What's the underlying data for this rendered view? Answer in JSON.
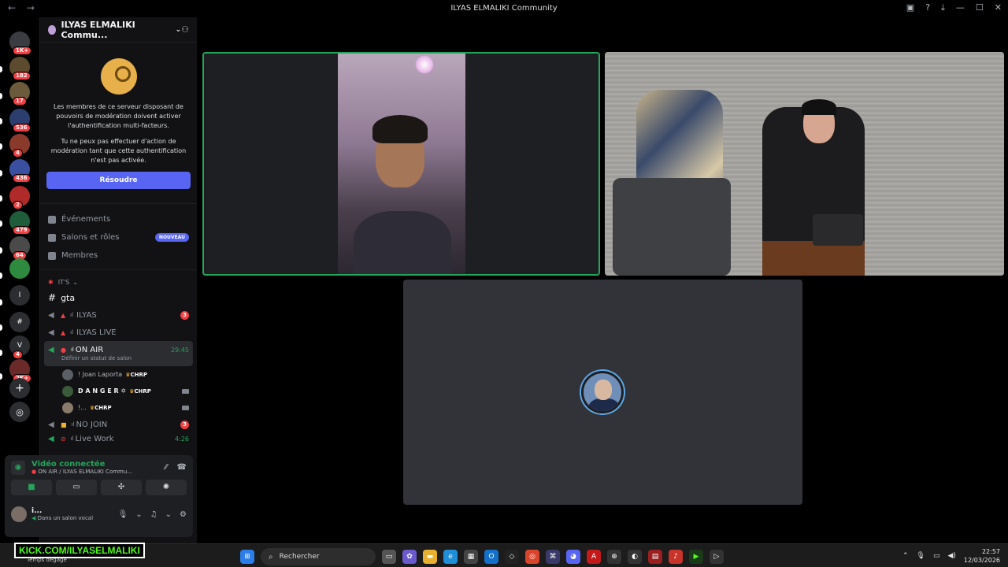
{
  "window": {
    "title": "ILYAS ELMALIKI Community",
    "nav_back": "←",
    "nav_forward": "→"
  },
  "guilds": [
    {
      "label": "1K+",
      "color": "#3a3c42"
    },
    {
      "label": "182",
      "color": "#5c4b2e"
    },
    {
      "label": "17",
      "color": "#6b5a3c"
    },
    {
      "label": "536",
      "color": "#2c3e6e"
    },
    {
      "label": "4",
      "color": "#8a3a2a"
    },
    {
      "label": "436",
      "color": "#3b4fa0"
    },
    {
      "label": "2",
      "color": "#b02a2a"
    },
    {
      "label": "479",
      "color": "#1f5c3a"
    },
    {
      "label": "64",
      "color": "#4a4a4a"
    },
    {
      "label": "",
      "color": "#2e8a3e"
    },
    {
      "label": "I",
      "color": "#2b2d31"
    },
    {
      "label": "#",
      "color": "#2b2d31"
    },
    {
      "label": "4",
      "color": "#2b2d31"
    },
    {
      "label": "2K+",
      "color": "#6a2a2a"
    }
  ],
  "guild_letters": {
    "i": "I",
    "v": "V"
  },
  "server": {
    "name": "ILYAS ELMALIKI Commu...",
    "mfa_text1": "Les membres de ce serveur disposant de pouvoirs de modération doivent activer l'authentification multi-facteurs.",
    "mfa_text2": "Tu ne peux pas effectuer d'action de modération tant que cette authentification n'est pas activée.",
    "resolve_button": "Résoudre"
  },
  "menu": [
    {
      "label": "Événements",
      "badge": ""
    },
    {
      "label": "Salons et rôles",
      "badge": "NOUVEAU"
    },
    {
      "label": "Membres",
      "badge": ""
    }
  ],
  "category": "IT'S",
  "text_channel": "gta",
  "channels": {
    "ilyas": {
      "label": "ILYAS",
      "count": "3"
    },
    "ilyas_live": {
      "label": "ILYAS LIVE"
    },
    "on_air": {
      "label": "ON AIR",
      "time": "29:45",
      "status": "Définir un statut de salon"
    },
    "no_join": {
      "label": "NO JOIN",
      "count": "3"
    },
    "live_work": {
      "label": "Live Work",
      "time": "4:26"
    }
  },
  "members": [
    {
      "name": "! Joan Laporta",
      "tag": "CHRP"
    },
    {
      "name": "D A N G E R ✡︎",
      "tag": "CHRP"
    },
    {
      "name": "!...",
      "tag": "CHRP"
    }
  ],
  "voice": {
    "status": "Vidéo connectée",
    "location": "ON AIR / ILYAS ELMALIKI Commu...",
    "user_name": "i...",
    "user_status": "Dans un salon vocal"
  },
  "taskbar": {
    "kick": "KICK.COM/ILYASELMALIKI",
    "weather": "Temps dégagé",
    "search": "Rechercher",
    "time": "22:57",
    "date": "12/03/2026"
  }
}
